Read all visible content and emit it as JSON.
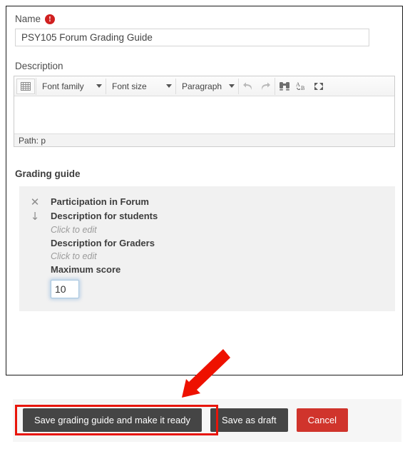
{
  "form": {
    "name_field": {
      "label": "Name",
      "required_icon": "exclamation-circle-icon",
      "required_marker": "!",
      "value": "PSY105 Forum Grading Guide",
      "placeholder": ""
    },
    "description_field": {
      "label": "Description",
      "editor": {
        "toolbar": {
          "grid_button": "table-grid-icon",
          "font_family": "Font family",
          "font_size": "Font size",
          "paragraph": "Paragraph",
          "undo": "undo-arrow-icon",
          "redo": "redo-arrow-icon",
          "find_replace": "binoculars-icon",
          "accessibility": "accessibility-checker-icon",
          "fullscreen": "fullscreen-icon"
        },
        "body_text": "",
        "status_path": "Path: p"
      }
    }
  },
  "grading_guide": {
    "title": "Grading guide",
    "criteria": [
      {
        "delete_icon": "close-x-icon",
        "move_icon": "move-down-arrow-icon",
        "criterion_name": "Participation in Forum",
        "students_heading": "Description for students",
        "students_value": "Click to edit",
        "graders_heading": "Description for Graders",
        "graders_value": "Click to edit",
        "max_score_heading": "Maximum score",
        "max_score_value": "10"
      }
    ]
  },
  "footer": {
    "save_ready_label": "Save grading guide and make it ready",
    "save_draft_label": "Save as draft",
    "cancel_label": "Cancel"
  },
  "annotation": {
    "arrow": "red-pointer-arrow",
    "highlight": "red-highlight-rectangle",
    "accent_red": "#e8150a",
    "button_dark": "#454545",
    "button_red": "#d0342c"
  }
}
